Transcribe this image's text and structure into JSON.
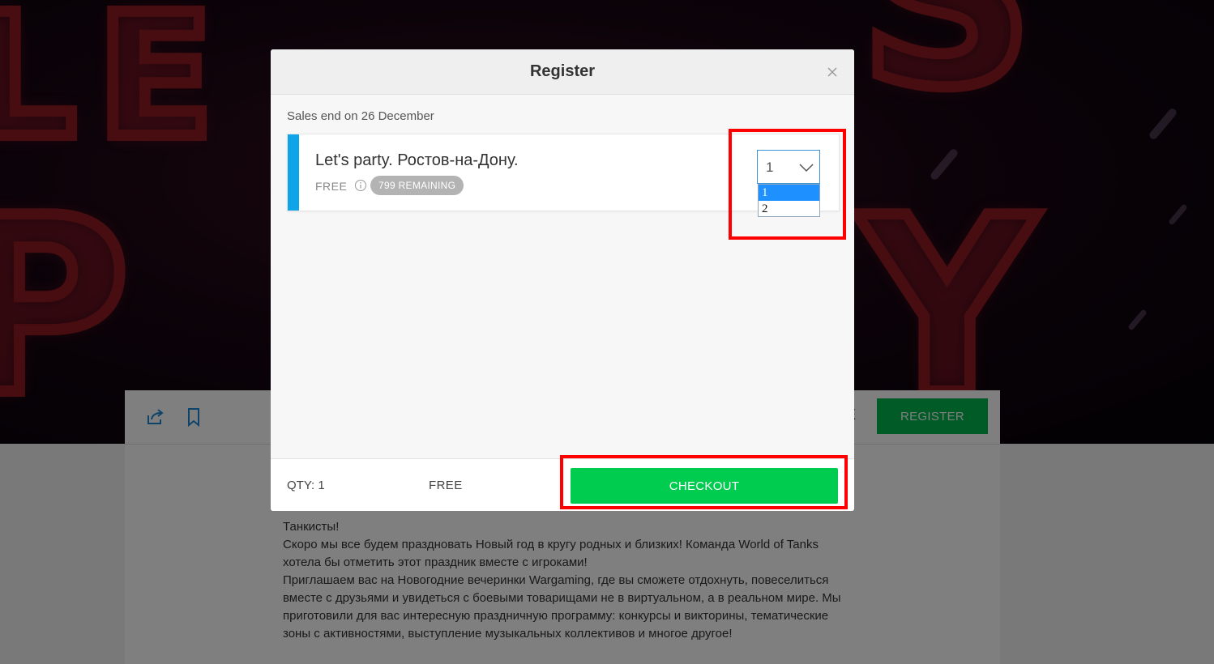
{
  "modal": {
    "title": "Register",
    "sales_end": "Sales end on 26 December",
    "ticket": {
      "name": "Let's party. Ростов-на-Дону.",
      "price": "FREE",
      "remaining": "799 REMAINING"
    },
    "quantity_select": {
      "value": "1",
      "options": [
        "1",
        "2"
      ],
      "highlighted_option": "1"
    },
    "footer": {
      "qty": "QTY: 1",
      "price": "FREE",
      "checkout_label": "CHECKOUT"
    }
  },
  "background": {
    "register_label": "REGISTER",
    "partial_label": "E",
    "description": [
      "Танкисты!",
      "Скоро мы все будем праздновать Новый год в кругу родных и близких! Команда World of Tanks хотела бы отметить этот праздник вместе с игроками!",
      "Приглашаем вас на Новогодние вечеринки Wargaming, где вы сможете отдохнуть, повеселиться вместе с друзьями и увидеться с боевыми товарищами не в виртуальном, а в реальном мире. Мы приготовили для вас интересную праздничную программу: конкурсы и викторины, тематические зоны с активностями, выступление музыкальных коллективов и многое другое!"
    ]
  },
  "colors": {
    "accent_blue": "#0fa3e8",
    "checkout_green": "#00cc50",
    "register_green": "#00b64f",
    "highlight_red": "#ff0000",
    "badge_gray": "#b3b3b3"
  },
  "icons": [
    "share-icon",
    "bookmark-icon",
    "close-icon",
    "info-icon",
    "chevron-down-icon"
  ]
}
